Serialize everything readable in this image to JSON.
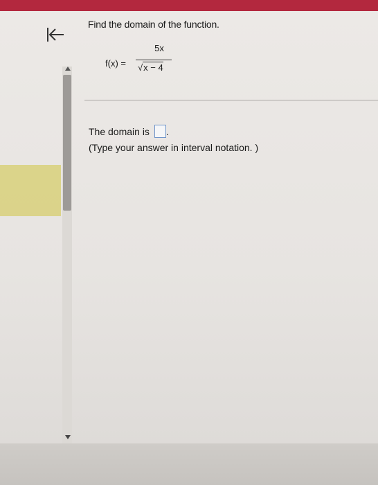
{
  "question": {
    "text": "Find the domain of the function."
  },
  "formula": {
    "lhs": "f(x) =",
    "numerator": "5x",
    "radical_symbol": "√",
    "radicand": "x − 4"
  },
  "answer": {
    "prompt": "The domain is",
    "period": ".",
    "value": "",
    "hint": "(Type your answer in interval notation. )"
  },
  "nav": {
    "back_icon": "first-page-icon"
  },
  "colors": {
    "top_bar": "#b3283e",
    "answer_box_border": "#6f94c9",
    "highlight": "#d8d07a"
  }
}
